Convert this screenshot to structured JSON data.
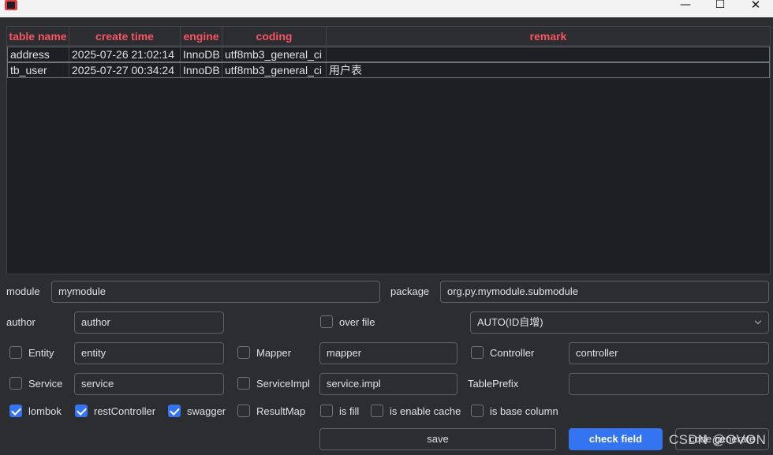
{
  "window": {
    "minimize_glyph": "—",
    "maximize_glyph": "☐",
    "close_glyph": "✕"
  },
  "table": {
    "columns": [
      "table name",
      "create time",
      "engine",
      "coding",
      "remark"
    ],
    "rows": [
      [
        "address",
        "2025-07-26 21:02:14",
        "InnoDB",
        "utf8mb3_general_ci",
        ""
      ],
      [
        "tb_user",
        "2025-07-27 00:34:24",
        "InnoDB",
        "utf8mb3_general_ci",
        "用户表"
      ]
    ],
    "header_color": "#f75464"
  },
  "form": {
    "module_label": "module",
    "module_value": "mymodule",
    "package_label": "package",
    "package_value": "org.py.mymodule.submodule",
    "author_label": "author",
    "author_value": "author",
    "over_file_label": "over file",
    "over_file_checked": false,
    "id_type_value": "AUTO(ID自增)",
    "entity_label": "Entity",
    "entity_checked": false,
    "entity_value": "entity",
    "mapper_label": "Mapper",
    "mapper_checked": false,
    "mapper_value": "mapper",
    "controller_label": "Controller",
    "controller_checked": false,
    "controller_value": "controller",
    "service_label": "Service",
    "service_checked": false,
    "service_value": "service",
    "serviceimpl_label": "ServiceImpl",
    "serviceimpl_checked": false,
    "serviceimpl_value": "service.impl",
    "tableprefix_label": "TablePrefix",
    "tableprefix_value": "",
    "lombok_label": "lombok",
    "lombok_checked": true,
    "restcontroller_label": "restController",
    "restcontroller_checked": true,
    "swagger_label": "swagger",
    "swagger_checked": true,
    "resultmap_label": "ResultMap",
    "resultmap_checked": false,
    "isfill_label": "is fill",
    "isfill_checked": false,
    "enable_cache_label": "is enable cache",
    "enable_cache_checked": false,
    "base_column_label": "is base column",
    "base_column_checked": false
  },
  "buttons": {
    "save": "save",
    "check_field": "check field",
    "code_generate": "code generate"
  },
  "colors": {
    "accent": "#3574f0",
    "background": "#2b2d30",
    "table_background": "#1e1f22"
  },
  "watermark": "CSDN @OVON"
}
